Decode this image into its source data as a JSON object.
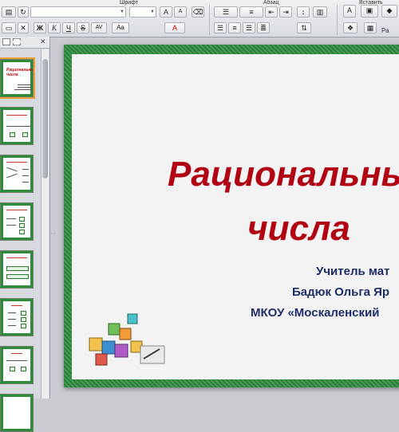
{
  "ribbon": {
    "groups": {
      "font": "Шрифт",
      "paragraph": "Абзац",
      "insert": "Вставить"
    },
    "font_buttons": {
      "bold": "Ж",
      "italic": "К",
      "underline": "Ч",
      "strike": "S",
      "grow": "A",
      "shrink": "A",
      "font_color": "A",
      "case": "Aa",
      "spacing": "AV"
    },
    "insert_label": "Ра"
  },
  "slides_panel": {
    "thumb_title": "Рациональные числа",
    "thumbnails": 8
  },
  "slide": {
    "title_line1": "Рациональны",
    "title_line2": "числа",
    "author_line1": "Учитель мат",
    "author_line2": "Бадюк Ольга Яр",
    "author_line3": "МКОУ «Москаленский",
    "colors": {
      "title": "#b00012",
      "author": "#1c2d6b",
      "frame": "#2f8f3f"
    }
  }
}
